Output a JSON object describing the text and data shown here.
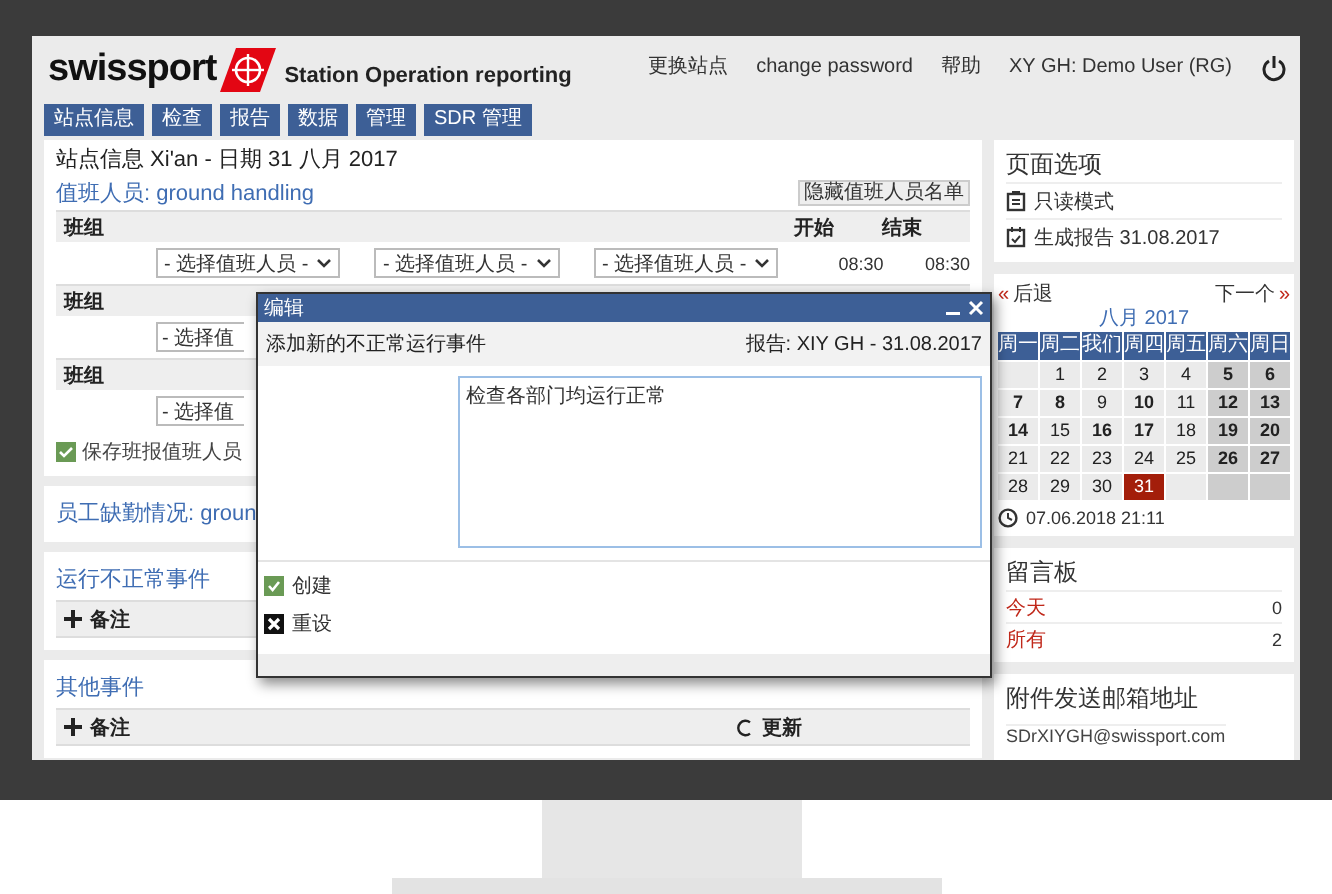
{
  "header": {
    "logo": "swissport",
    "app_title": "Station Operation reporting",
    "links": [
      "更换站点",
      "change password",
      "帮助",
      "XY GH: Demo User (RG)"
    ]
  },
  "nav": [
    "站点信息",
    "检查",
    "报告",
    "数据",
    "管理",
    "SDR 管理"
  ],
  "station": {
    "title": "站点信息 Xi'an - 日期 31 八月 2017",
    "staff_heading": "值班人员: ground handling",
    "hide_button": "隐藏值班人员名单",
    "groups": [
      {
        "label": "班组",
        "start_label": "开始",
        "end_label": "结束",
        "selects": [
          "- 选择值班人员 -",
          "- 选择值班人员 -",
          "- 选择值班人员 -"
        ],
        "start": "08:30",
        "end": "08:30"
      },
      {
        "label": "班组",
        "selects": [
          "- 选择值"
        ]
      },
      {
        "label": "班组",
        "selects": [
          "- 选择值"
        ]
      }
    ],
    "save_option": {
      "label": "保存班报值班人员",
      "checked": true
    }
  },
  "absence": {
    "heading": "员工缺勤情况: groun"
  },
  "irregular": {
    "heading": "运行不正常事件",
    "add_label": "备注"
  },
  "other": {
    "heading": "其他事件",
    "add_label": "备注",
    "refresh_label": "更新"
  },
  "page_options": {
    "title": "页面选项",
    "items": [
      {
        "kind": "readonly",
        "label": "只读模式"
      },
      {
        "kind": "report",
        "label": "生成报告 31.08.2017"
      }
    ]
  },
  "calendar": {
    "prev_arrow": "«",
    "prev": "后退",
    "next": "下一个",
    "next_arrow": "»",
    "month": "八月 2017",
    "weekdays": [
      "周一",
      "周二",
      "我们",
      "周四",
      "周五",
      "周六",
      "周日"
    ],
    "weeks": [
      [
        {
          "kind": "blank",
          "weekend": false
        },
        {
          "kind": "day",
          "day": "1",
          "weekend": false,
          "marked": false,
          "selected": false
        },
        {
          "kind": "day",
          "day": "2",
          "weekend": false,
          "marked": false,
          "selected": false
        },
        {
          "kind": "day",
          "day": "3",
          "weekend": false,
          "marked": false,
          "selected": false
        },
        {
          "kind": "day",
          "day": "4",
          "weekend": false,
          "marked": false,
          "selected": false
        },
        {
          "kind": "day",
          "day": "5",
          "weekend": true,
          "marked": true,
          "selected": false
        },
        {
          "kind": "day",
          "day": "6",
          "weekend": true,
          "marked": true,
          "selected": false
        }
      ],
      [
        {
          "kind": "day",
          "day": "7",
          "weekend": false,
          "marked": true,
          "selected": false
        },
        {
          "kind": "day",
          "day": "8",
          "weekend": false,
          "marked": true,
          "selected": false
        },
        {
          "kind": "day",
          "day": "9",
          "weekend": false,
          "marked": false,
          "selected": false
        },
        {
          "kind": "day",
          "day": "10",
          "weekend": false,
          "marked": true,
          "selected": false
        },
        {
          "kind": "day",
          "day": "11",
          "weekend": false,
          "marked": false,
          "selected": false
        },
        {
          "kind": "day",
          "day": "12",
          "weekend": true,
          "marked": true,
          "selected": false
        },
        {
          "kind": "day",
          "day": "13",
          "weekend": true,
          "marked": true,
          "selected": false
        }
      ],
      [
        {
          "kind": "day",
          "day": "14",
          "weekend": false,
          "marked": true,
          "selected": false
        },
        {
          "kind": "day",
          "day": "15",
          "weekend": false,
          "marked": false,
          "selected": false
        },
        {
          "kind": "day",
          "day": "16",
          "weekend": false,
          "marked": true,
          "selected": false
        },
        {
          "kind": "day",
          "day": "17",
          "weekend": false,
          "marked": true,
          "selected": false
        },
        {
          "kind": "day",
          "day": "18",
          "weekend": false,
          "marked": false,
          "selected": false
        },
        {
          "kind": "day",
          "day": "19",
          "weekend": true,
          "marked": true,
          "selected": false
        },
        {
          "kind": "day",
          "day": "20",
          "weekend": true,
          "marked": true,
          "selected": false
        }
      ],
      [
        {
          "kind": "day",
          "day": "21",
          "weekend": false,
          "marked": false,
          "selected": false
        },
        {
          "kind": "day",
          "day": "22",
          "weekend": false,
          "marked": false,
          "selected": false
        },
        {
          "kind": "day",
          "day": "23",
          "weekend": false,
          "marked": false,
          "selected": false
        },
        {
          "kind": "day",
          "day": "24",
          "weekend": false,
          "marked": false,
          "selected": false
        },
        {
          "kind": "day",
          "day": "25",
          "weekend": false,
          "marked": false,
          "selected": false
        },
        {
          "kind": "day",
          "day": "26",
          "weekend": true,
          "marked": true,
          "selected": false
        },
        {
          "kind": "day",
          "day": "27",
          "weekend": true,
          "marked": true,
          "selected": false
        }
      ],
      [
        {
          "kind": "day",
          "day": "28",
          "weekend": false,
          "marked": false,
          "selected": false
        },
        {
          "kind": "day",
          "day": "29",
          "weekend": false,
          "marked": false,
          "selected": false
        },
        {
          "kind": "day",
          "day": "30",
          "weekend": false,
          "marked": false,
          "selected": false
        },
        {
          "kind": "day",
          "day": "31",
          "weekend": false,
          "marked": false,
          "selected": true
        },
        {
          "kind": "blank",
          "weekend": false
        },
        {
          "kind": "blank",
          "weekend": true
        },
        {
          "kind": "blank",
          "weekend": true
        }
      ]
    ],
    "timestamp": "07.06.2018 21:11"
  },
  "messages": {
    "title": "留言板",
    "rows": [
      {
        "label": "今天",
        "count": "0"
      },
      {
        "label": "所有",
        "count": "2"
      }
    ]
  },
  "mail": {
    "title": "附件发送邮箱地址",
    "address": "SDrXIYGH@swissport.com"
  },
  "dialog": {
    "title": "编辑",
    "subtitle": "添加新的不正常运行事件",
    "report": "报告: XIY GH - 31.08.2017",
    "text": "检查各部门均运行正常",
    "actions": [
      {
        "kind": "create",
        "label": "创建"
      },
      {
        "kind": "reset",
        "label": "重设"
      }
    ]
  }
}
